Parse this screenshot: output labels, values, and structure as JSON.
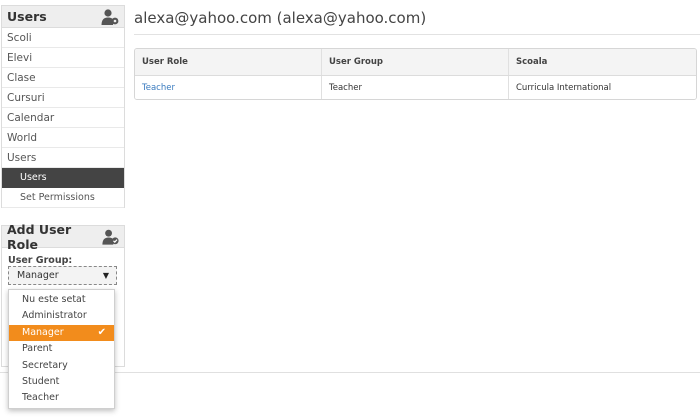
{
  "sidebar": {
    "title": "Users",
    "items": [
      {
        "label": "Scoli"
      },
      {
        "label": "Elevi"
      },
      {
        "label": "Clase"
      },
      {
        "label": "Cursuri"
      },
      {
        "label": "Calendar"
      },
      {
        "label": "World"
      },
      {
        "label": "Users"
      },
      {
        "label": "Users",
        "active": true
      },
      {
        "label": "Set Permissions"
      }
    ]
  },
  "role_panel": {
    "title": "Add User Role",
    "field_label": "User Group:",
    "selected": "Manager",
    "options": [
      "Nu este setat",
      "Administrator",
      "Manager",
      "Parent",
      "Secretary",
      "Student",
      "Teacher"
    ]
  },
  "main": {
    "title": "alexa@yahoo.com (alexa@yahoo.com)",
    "table": {
      "headers": [
        "User Role",
        "User Group",
        "Scoala"
      ],
      "rows": [
        [
          "Teacher",
          "Teacher",
          "Curricula International"
        ]
      ]
    }
  },
  "colors": {
    "accent": "#f28c1c",
    "active_nav": "#444444",
    "link": "#3a7bbf"
  }
}
